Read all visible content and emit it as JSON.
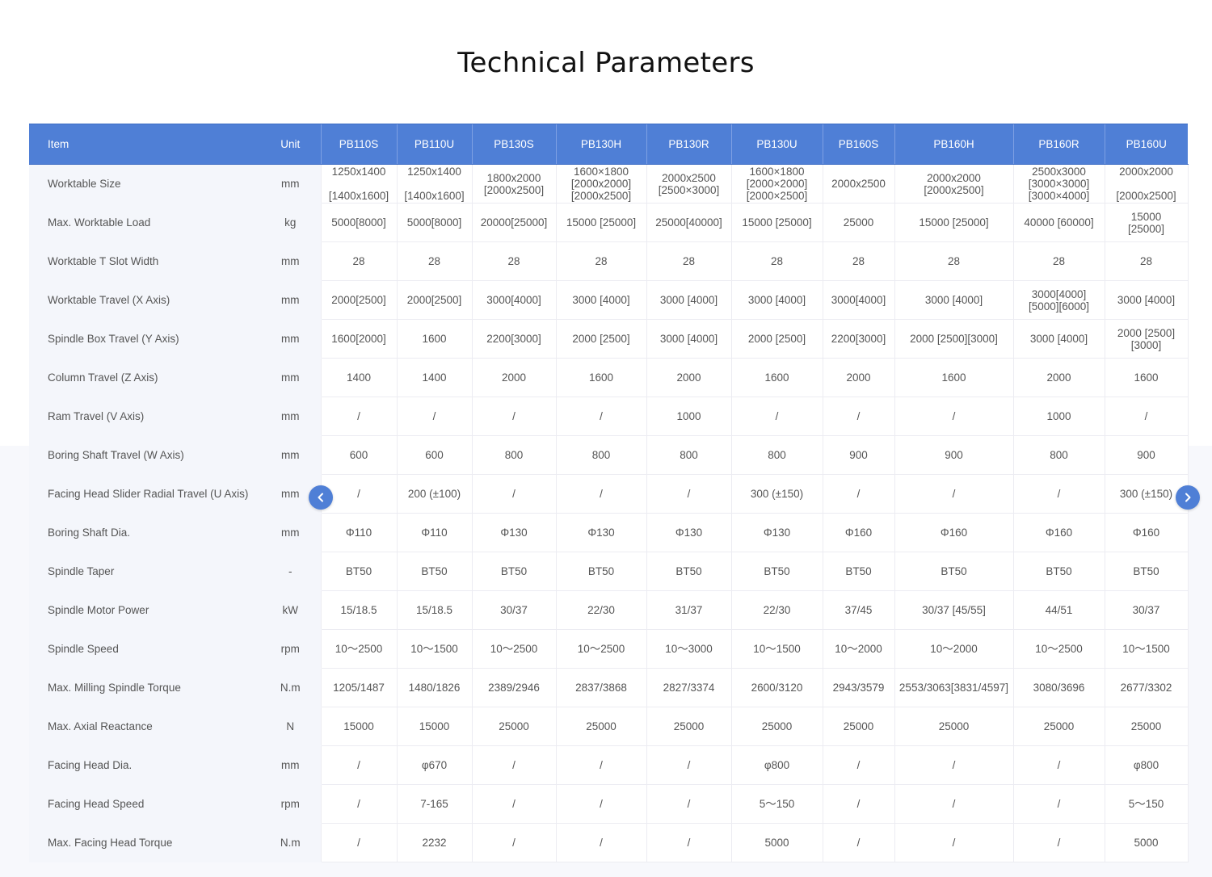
{
  "page": {
    "title": "Technical Parameters"
  },
  "colors": {
    "header": "#4f7fd6",
    "label_bg": "#f4f6fb"
  },
  "icons": {
    "prev": "chevron-left-icon",
    "next": "chevron-right-icon"
  },
  "table": {
    "headers": {
      "item": "Item",
      "unit": "Unit",
      "models": [
        "PB110S",
        "PB110U",
        "PB130S",
        "PB130H",
        "PB130R",
        "PB130U",
        "PB160S",
        "PB160H",
        "PB160R",
        "PB160U"
      ]
    },
    "rows": [
      {
        "item": "Worktable Size",
        "unit": "mm",
        "values": [
          "1250x1400\n\n[1400x1600]",
          "1250x1400\n\n[1400x1600]",
          "1800x2000\n[2000x2500]",
          "1600×1800\n[2000x2000]\n[2000x2500]",
          "2000x2500\n[2500×3000]",
          "1600×1800\n[2000×2000]\n[2000×2500]",
          "2000x2500",
          "2000x2000\n[2000x2500]",
          "2500x3000\n[3000×3000]\n[3000×4000]",
          "2000x2000\n\n[2000x2500]"
        ]
      },
      {
        "item": "Max. Worktable Load",
        "unit": "kg",
        "values": [
          "5000[8000]",
          "5000[8000]",
          "20000[25000]",
          "15000 [25000]",
          "25000[40000]",
          "15000 [25000]",
          "25000",
          "15000 [25000]",
          "40000 [60000]",
          "15000\n[25000]"
        ]
      },
      {
        "item": "Worktable T Slot Width",
        "unit": "mm",
        "values": [
          "28",
          "28",
          "28",
          "28",
          "28",
          "28",
          "28",
          "28",
          "28",
          "28"
        ]
      },
      {
        "item": "Worktable Travel (X Axis)",
        "unit": "mm",
        "values": [
          "2000[2500]",
          "2000[2500]",
          "3000[4000]",
          "3000 [4000]",
          "3000 [4000]",
          "3000 [4000]",
          "3000[4000]",
          "3000 [4000]",
          "3000[4000]\n[5000][6000]",
          "3000 [4000]"
        ]
      },
      {
        "item": "Spindle Box Travel (Y Axis)",
        "unit": "mm",
        "values": [
          "1600[2000]",
          "1600",
          "2200[3000]",
          "2000 [2500]",
          "3000 [4000]",
          "2000 [2500]",
          "2200[3000]",
          "2000 [2500][3000]",
          "3000 [4000]",
          "2000 [2500]\n[3000]"
        ]
      },
      {
        "item": "Column Travel (Z Axis)",
        "unit": "mm",
        "values": [
          "1400",
          "1400",
          "2000",
          "1600",
          "2000",
          "1600",
          "2000",
          "1600",
          "2000",
          "1600"
        ]
      },
      {
        "item": "Ram Travel (V Axis)",
        "unit": "mm",
        "values": [
          "/",
          "/",
          "/",
          "/",
          "1000",
          "/",
          "/",
          "/",
          "1000",
          "/"
        ]
      },
      {
        "item": "Boring Shaft Travel (W Axis)",
        "unit": "mm",
        "values": [
          "600",
          "600",
          "800",
          "800",
          "800",
          "800",
          "900",
          "900",
          "800",
          "900"
        ]
      },
      {
        "item": "Facing Head Slider Radial Travel (U Axis)",
        "unit": "mm",
        "values": [
          "/",
          "200 (±100)",
          "/",
          "/",
          "/",
          "300 (±150)",
          "/",
          "/",
          "/",
          "300 (±150)"
        ]
      },
      {
        "item": "Boring Shaft Dia.",
        "unit": "mm",
        "values": [
          "Φ110",
          "Φ110",
          "Φ130",
          "Φ130",
          "Φ130",
          "Φ130",
          "Φ160",
          "Φ160",
          "Φ160",
          "Φ160"
        ]
      },
      {
        "item": "Spindle Taper",
        "unit": "-",
        "values": [
          "BT50",
          "BT50",
          "BT50",
          "BT50",
          "BT50",
          "BT50",
          "BT50",
          "BT50",
          "BT50",
          "BT50"
        ]
      },
      {
        "item": "Spindle Motor Power",
        "unit": "kW",
        "values": [
          "15/18.5",
          "15/18.5",
          "30/37",
          "22/30",
          "31/37",
          "22/30",
          "37/45",
          "30/37 [45/55]",
          "44/51",
          "30/37"
        ]
      },
      {
        "item": "Spindle Speed",
        "unit": "rpm",
        "values": [
          "10～2500",
          "10～1500",
          "10～2500",
          "10～2500",
          "10～3000",
          "10～1500",
          "10～2000",
          "10～2000",
          "10～2500",
          "10～1500"
        ]
      },
      {
        "item": "Max. Milling Spindle Torque",
        "unit": "N.m",
        "values": [
          "1205/1487",
          "1480/1826",
          "2389/2946",
          "2837/3868",
          "2827/3374",
          "2600/3120",
          "2943/3579",
          "2553/3063[3831/4597]",
          "3080/3696",
          "2677/3302"
        ]
      },
      {
        "item": "Max. Axial Reactance",
        "unit": "N",
        "values": [
          "15000",
          "15000",
          "25000",
          "25000",
          "25000",
          "25000",
          "25000",
          "25000",
          "25000",
          "25000"
        ]
      },
      {
        "item": "Facing Head Dia.",
        "unit": "mm",
        "values": [
          "/",
          "φ670",
          "/",
          "/",
          "/",
          "φ800",
          "/",
          "/",
          "/",
          "φ800"
        ]
      },
      {
        "item": "Facing Head Speed",
        "unit": "rpm",
        "values": [
          "/",
          "7-165",
          "/",
          "/",
          "/",
          "5～150",
          "/",
          "/",
          "/",
          "5～150"
        ]
      },
      {
        "item": "Max. Facing Head Torque",
        "unit": "N.m",
        "values": [
          "/",
          "2232",
          "/",
          "/",
          "/",
          "5000",
          "/",
          "/",
          "/",
          "5000"
        ]
      }
    ]
  }
}
